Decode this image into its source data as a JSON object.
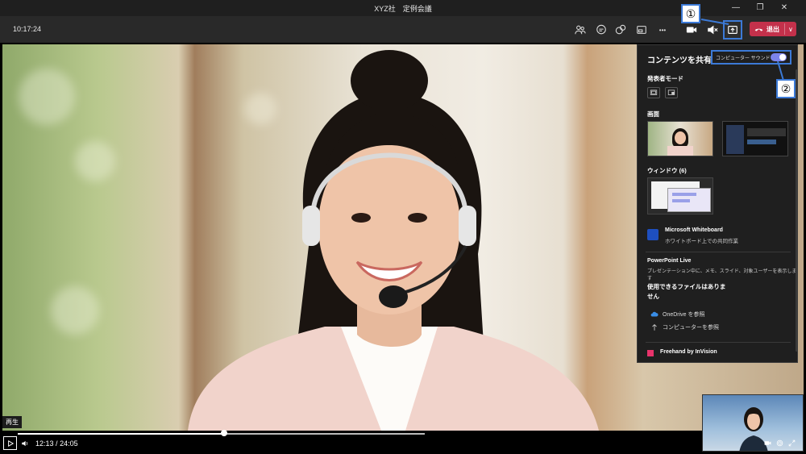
{
  "window": {
    "title": "XYZ社　定例会議",
    "minimize_glyph": "—",
    "maximize_glyph": "❐",
    "close_glyph": "✕"
  },
  "toolbar": {
    "clock": "10:17:24",
    "leave_label": "退出",
    "leave_chevron": "∨",
    "more_glyph": "•••"
  },
  "share_panel": {
    "title": "コンテンツを共有",
    "include_sound_label": "コンピューター サウンドを含む",
    "include_sound_on": true,
    "presenter_mode_label": "発表者モード",
    "screen_label": "画面",
    "window_label": "ウィンドウ (6)",
    "whiteboard_title": "Microsoft Whiteboard",
    "whiteboard_sub": "ホワイトボード上での共同作業",
    "powerpoint_title": "PowerPoint Live",
    "powerpoint_sub": "プレゼンテーション中に、メモ、スライド、対象ユーザーを表示します",
    "no_files_line1": "使用できるファイルはありま",
    "no_files_line2": "せん",
    "onedrive_label": "OneDrive を参照",
    "computer_label": "コンピューターを参照",
    "freehand_label": "Freehand by InVision",
    "accent_color": "#7b83eb"
  },
  "video_player": {
    "tooltip": "再生",
    "current_time": "12:13",
    "separator": "/",
    "duration": "24:05",
    "progress": 0.507
  },
  "callouts": {
    "one": "①",
    "two": "②",
    "color": "#3c7ad7"
  },
  "colors": {
    "leave_button": "#c4314b",
    "panel_bg": "#1f1f1f"
  }
}
